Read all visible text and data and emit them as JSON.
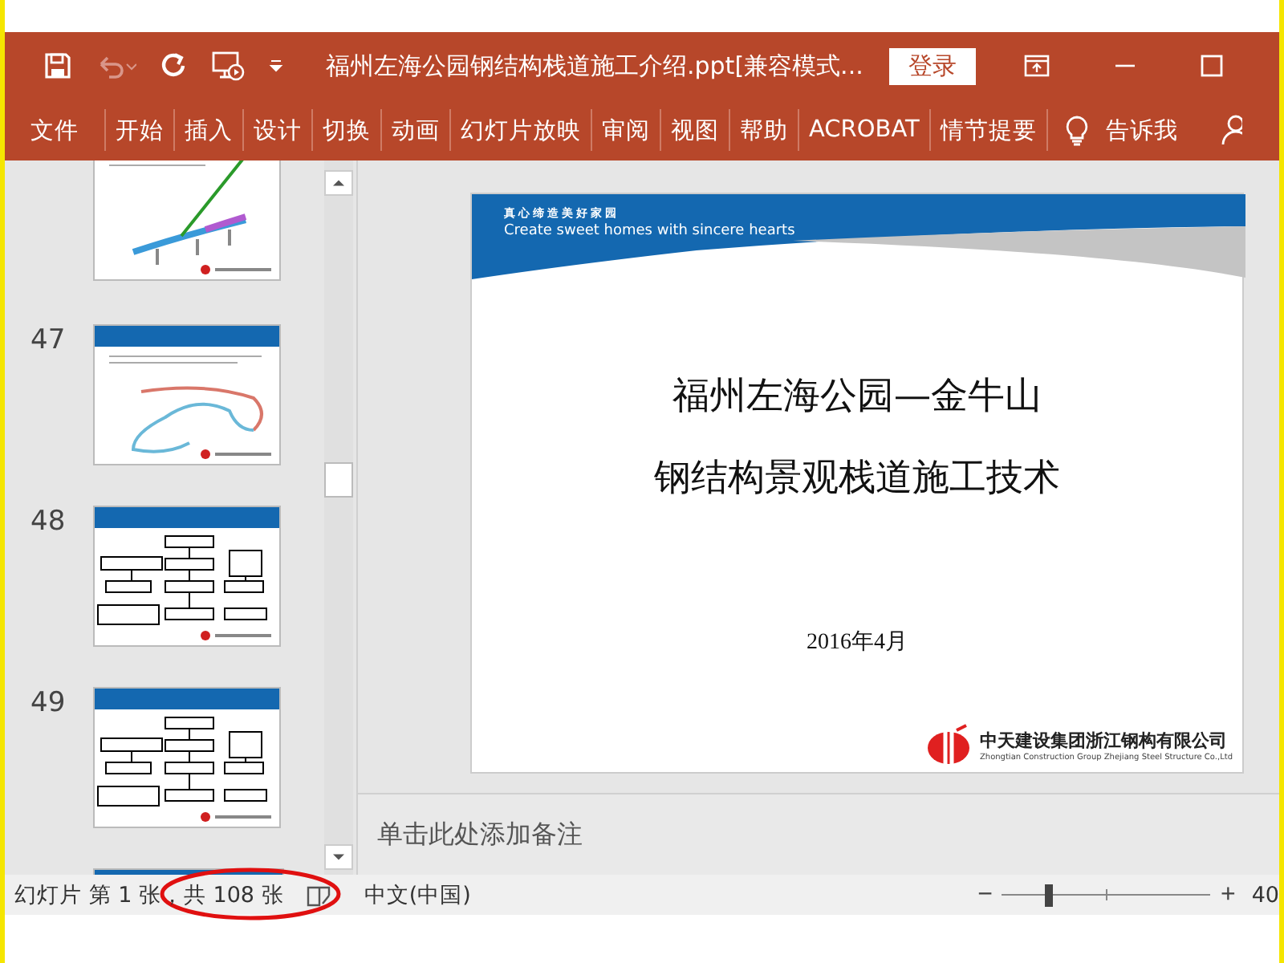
{
  "title_bar": {
    "title": "福州左海公园钢结构栈道施工介绍.ppt[兼容模式...",
    "login": "登录"
  },
  "ribbon": {
    "tabs": [
      {
        "label": "文件"
      },
      {
        "label": "开始"
      },
      {
        "label": "插入"
      },
      {
        "label": "设计"
      },
      {
        "label": "切换"
      },
      {
        "label": "动画"
      },
      {
        "label": "幻灯片放映"
      },
      {
        "label": "审阅"
      },
      {
        "label": "视图"
      },
      {
        "label": "帮助"
      },
      {
        "label": "ACROBAT"
      },
      {
        "label": "情节提要"
      }
    ],
    "tell_me": "告诉我"
  },
  "thumbnails": [
    {
      "kind": "drawing"
    },
    {
      "number": "47",
      "kind": "curve"
    },
    {
      "number": "48",
      "kind": "flowchart"
    },
    {
      "number": "49",
      "kind": "flowchart"
    }
  ],
  "slide": {
    "header_cn": "真心缔造美好家园",
    "header_en": "Create sweet homes with sincere hearts",
    "title_lines": [
      "福州左海公园—金牛山",
      "钢结构景观栈道施工技术"
    ],
    "date": "2016年4月",
    "company_cn": "中天建设集团浙江钢构有限公司",
    "company_en": "Zhongtian Construction Group Zhejiang Steel Structure Co.,Ltd"
  },
  "notes": {
    "placeholder": "单击此处添加备注"
  },
  "status_bar": {
    "slide_info": "幻灯片 第 1 张，共 108 张",
    "language": "中文(中国)",
    "zoom_minus": "−",
    "zoom_plus": "+",
    "zoom": {
      "level": 0.22
    },
    "zoom_percent": "40"
  }
}
